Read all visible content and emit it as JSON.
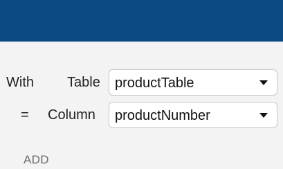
{
  "colors": {
    "header_bar": "#0c4a84",
    "panel_background": "#f3f3f3",
    "dropdown_border": "#c8c8c8",
    "add_text": "#6b6b6b"
  },
  "rows": [
    {
      "prefix": "With",
      "label": "Table",
      "select": {
        "value": "productTable",
        "icon": "caret-down-icon"
      }
    },
    {
      "prefix": "=",
      "label": "Column",
      "select": {
        "value": "productNumber",
        "icon": "caret-down-icon"
      }
    }
  ],
  "actions": {
    "add_label": "ADD"
  }
}
